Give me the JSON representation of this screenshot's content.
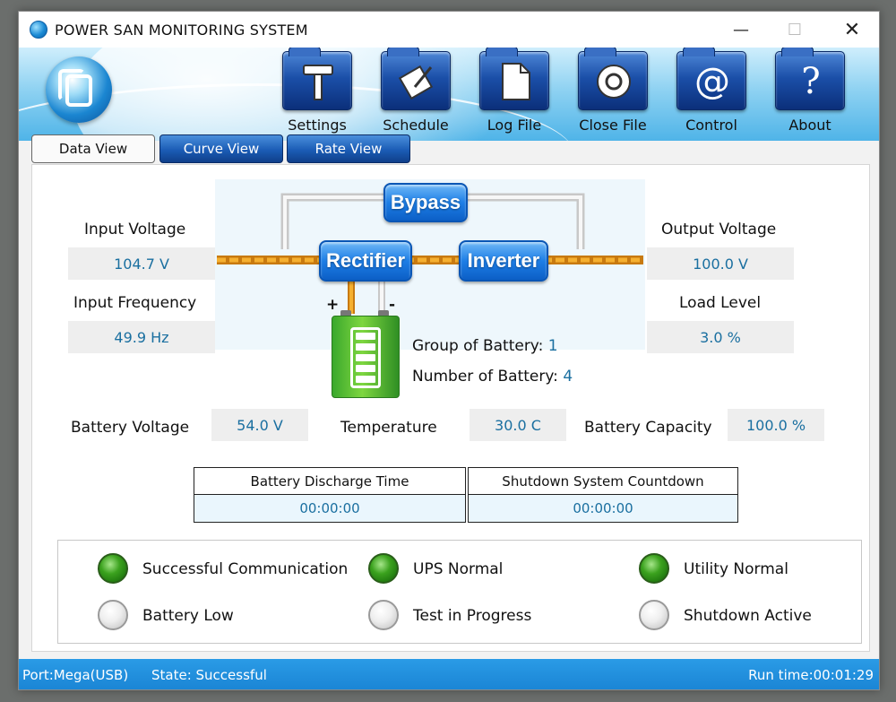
{
  "window": {
    "title": "POWER SAN MONITORING SYSTEM",
    "controls": {
      "minimize": "—",
      "maximize": "☐",
      "close": "✕"
    }
  },
  "toolbar": [
    {
      "label": "Settings",
      "icon": "hammer-icon"
    },
    {
      "label": "Schedule",
      "icon": "edit-icon"
    },
    {
      "label": "Log File",
      "icon": "document-icon"
    },
    {
      "label": "Close File",
      "icon": "disc-icon"
    },
    {
      "label": "Control",
      "icon": "at-icon"
    },
    {
      "label": "About",
      "icon": "question-icon"
    }
  ],
  "tabs": [
    {
      "label": "Data View",
      "active": true
    },
    {
      "label": "Curve View",
      "active": false
    },
    {
      "label": "Rate View",
      "active": false
    }
  ],
  "data_view": {
    "input_voltage": {
      "label": "Input Voltage",
      "value": "104.7 V"
    },
    "input_frequency": {
      "label": "Input Frequency",
      "value": "49.9 Hz"
    },
    "output_voltage": {
      "label": "Output Voltage",
      "value": "100.0 V"
    },
    "load_level": {
      "label": "Load Level",
      "value": "3.0 %"
    },
    "diagram": {
      "bypass": "Bypass",
      "rectifier": "Rectifier",
      "inverter": "Inverter",
      "plus": "+",
      "minus": "-"
    },
    "group_of_battery": {
      "label": "Group of Battery:",
      "value": "1"
    },
    "number_of_battery": {
      "label": "Number of Battery:",
      "value": "4"
    },
    "battery_voltage": {
      "label": "Battery Voltage",
      "value": "54.0 V"
    },
    "temperature": {
      "label": "Temperature",
      "value": "30.0 C"
    },
    "battery_capacity": {
      "label": "Battery Capacity",
      "value": "100.0 %"
    },
    "battery_discharge_time": {
      "label": "Battery Discharge Time",
      "value": "00:00:00"
    },
    "shutdown_countdown": {
      "label": "Shutdown System Countdown",
      "value": "00:00:00"
    }
  },
  "status": [
    {
      "label": "Successful Communication",
      "on": true
    },
    {
      "label": "UPS Normal",
      "on": true
    },
    {
      "label": "Utility Normal",
      "on": true
    },
    {
      "label": "Battery Low",
      "on": false
    },
    {
      "label": "Test in Progress",
      "on": false
    },
    {
      "label": "Shutdown Active",
      "on": false
    }
  ],
  "statusbar": {
    "port": "Port:Mega(USB)",
    "state": "State: Successful",
    "runtime": "Run time:00:01:29"
  },
  "colors": {
    "accent_blue": "#1a84d4",
    "value_text": "#1a6fa0",
    "led_on": "#3ba21e",
    "bus_line": "#f0a020"
  }
}
